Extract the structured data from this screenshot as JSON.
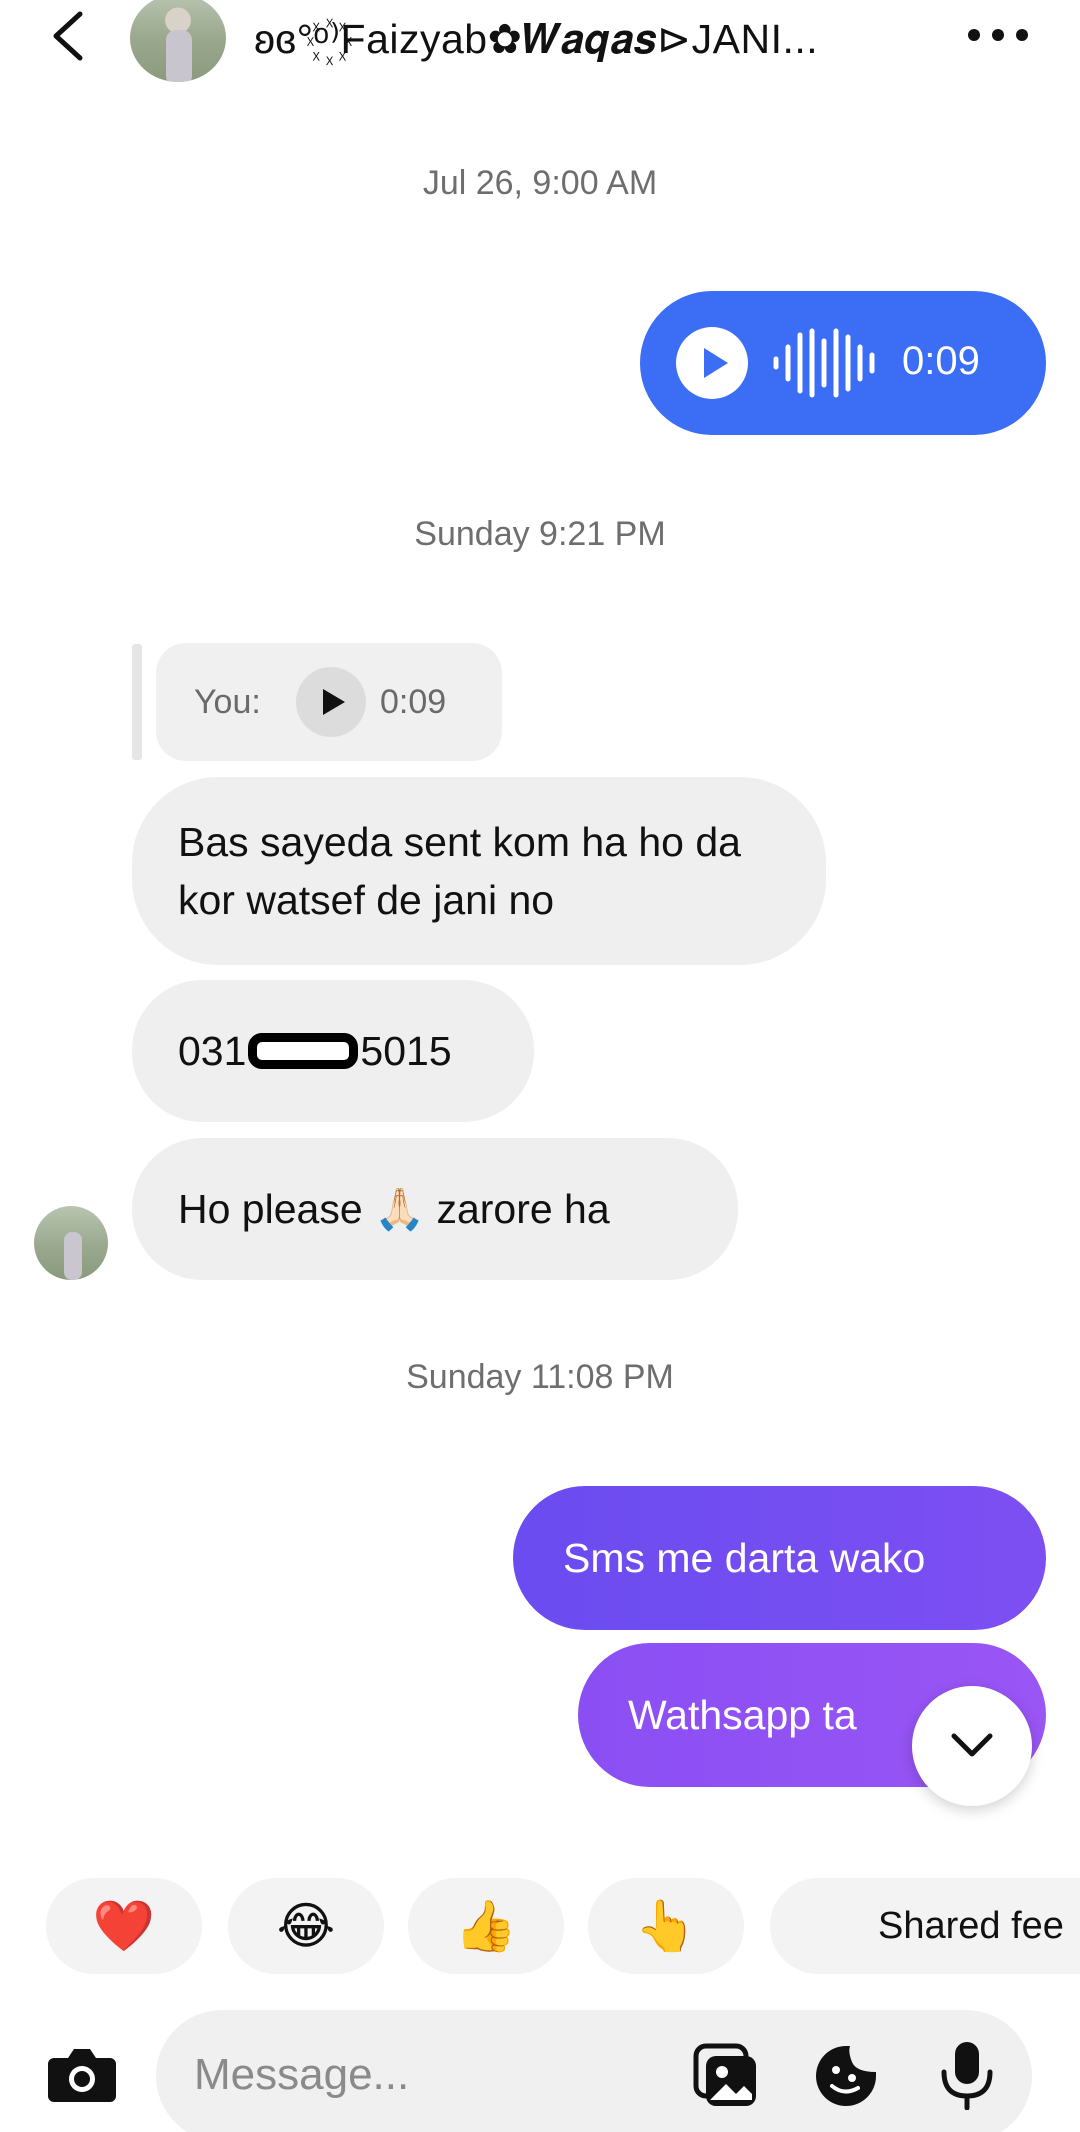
{
  "header": {
    "title": "ʚɞ°ᵒ꙰⁾Faizyab✿𝑾𝒂𝒒𝒂𝒔⊳JANI..."
  },
  "messages": {
    "ts1": "Jul 26, 9:00 AM",
    "voice_out_duration": "0:09",
    "ts2": "Sunday 9:21 PM",
    "reply_prefix": "You:",
    "reply_duration": "0:09",
    "msg1": "Bas sayeda sent kom ha ho da kor watsef de jani no",
    "msg2_start": "031",
    "msg2_end": "5015",
    "msg3": "Ho please 🙏🏻 zarore ha",
    "ts3": "Sunday 11:08 PM",
    "out1": "Sms me darta wako",
    "out2": "Wathsapp ta"
  },
  "reactions": [
    "❤️",
    "😂",
    "👍",
    "👆"
  ],
  "shared_chip": "Shared fee",
  "composer": {
    "placeholder": "Message..."
  },
  "colors": {
    "voice_bubble": "#3b6df5",
    "out_bubble": "#7a4ff2",
    "in_bubble": "#efefef"
  }
}
